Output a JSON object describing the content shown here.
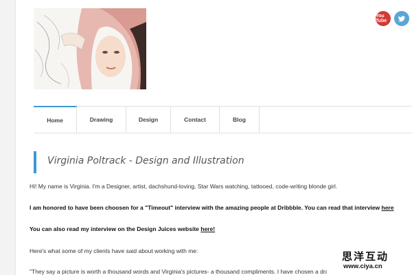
{
  "social": {
    "youtube_label": "You Tube",
    "twitter_icon": "twitter-bird-icon"
  },
  "nav": [
    {
      "label": "Home",
      "active": true
    },
    {
      "label": "Drawing"
    },
    {
      "label": "Design"
    },
    {
      "label": "Contact"
    },
    {
      "label": "Blog"
    }
  ],
  "title": "Virginia Poltrack - Design and Illustration",
  "paragraphs": {
    "intro": "Hi! My name is Virginia. I'm a Designer, artist, dachshund-loving, Star Wars watching, tattooed, code-writing blonde girl.",
    "timeout_text": "I am honored to have been choosen for a \"Timeout\" interview with the amazing people at Dribbble. You can read that interview ",
    "timeout_link": "here",
    "design_juices_text": "You can also read my interview on the Design Juices website ",
    "design_juices_link": "here!",
    "clients": "Here's what some of my clients have said about working with me:",
    "quote": "\"They say a picture is worth a thousand words and Virginia's pictures- a thousand compliments. I have chosen a drawing of Virginia's to be my unive"
  },
  "watermark": {
    "chinese": "思洋互动",
    "url": "www.ciya.cn"
  },
  "colors": {
    "accent": "#3b99d6",
    "youtube": "#d33a34",
    "twitter": "#5aa7d6"
  }
}
